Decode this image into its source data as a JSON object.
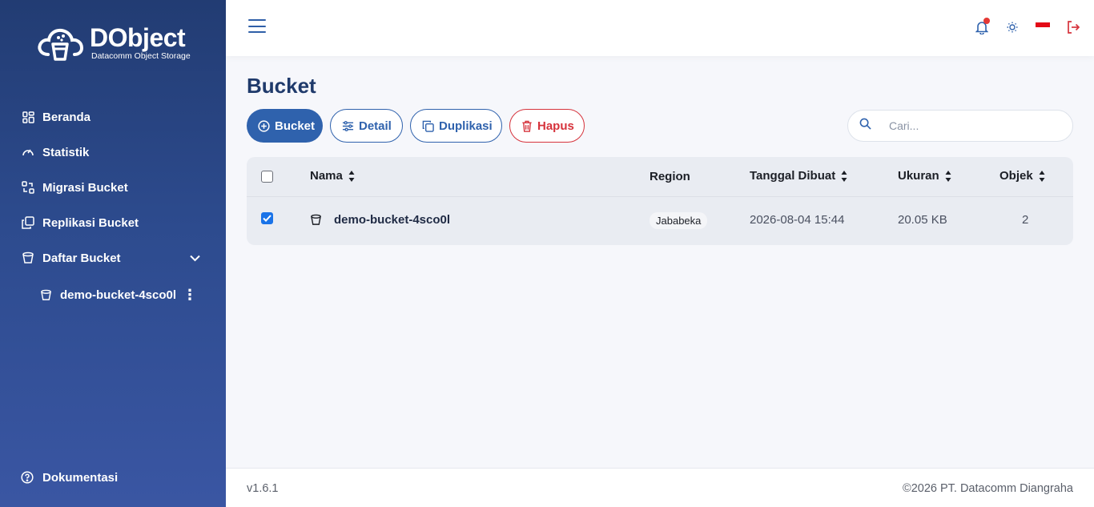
{
  "brand": {
    "title": "DObject",
    "subtitle": "Datacomm Object Storage"
  },
  "sidebar": {
    "items": [
      {
        "label": "Beranda",
        "icon": "dashboard-icon"
      },
      {
        "label": "Statistik",
        "icon": "gauge-icon"
      },
      {
        "label": "Migrasi Bucket",
        "icon": "migrate-icon"
      },
      {
        "label": "Replikasi Bucket",
        "icon": "copy-icon"
      },
      {
        "label": "Daftar Bucket",
        "icon": "bucket-icon"
      }
    ],
    "sub_items": [
      {
        "label": "demo-bucket-4sco0l",
        "icon": "bucket-icon"
      }
    ],
    "docs": {
      "label": "Dokumentasi",
      "icon": "help-circle-icon"
    }
  },
  "topbar": {
    "flag": "indonesia-flag",
    "accent": "#2f62ad"
  },
  "page": {
    "title": "Bucket"
  },
  "toolbar": {
    "add_label": "Bucket",
    "detail_label": "Detail",
    "duplicate_label": "Duplikasi",
    "delete_label": "Hapus",
    "search_placeholder": "Cari..."
  },
  "table": {
    "headers": {
      "name": "Nama",
      "region": "Region",
      "created": "Tanggal Dibuat",
      "size": "Ukuran",
      "objects": "Objek"
    },
    "rows": [
      {
        "name": "demo-bucket-4sco0l",
        "region": "Jababeka",
        "created": "2026-08-04 15:44",
        "size": "20.05 KB",
        "objects": "2",
        "checked": true
      }
    ]
  },
  "footer": {
    "version": "v1.6.1",
    "copyright": "©2026 PT. Datacomm Diangraha"
  },
  "colors": {
    "danger": "#d6333c",
    "sidebar": "#2d4b8e"
  }
}
